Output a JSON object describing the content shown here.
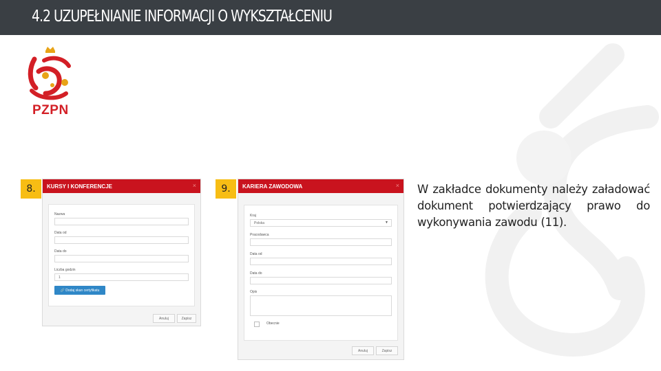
{
  "header": {
    "title": "4.2 UZUPEŁNIANIE INFORMACJI O WYKSZTAŁCENIU"
  },
  "logo": {
    "text": "PZPN"
  },
  "colors": {
    "header_bg": "#3a3f44",
    "accent_red": "#c9131e",
    "badge_yellow": "#f7bd14",
    "button_blue": "#2f87c7"
  },
  "step8": {
    "badge": "8.",
    "modal_title": "KURSY I KONFERENCJE",
    "close_icon": "×",
    "fields": [
      {
        "label": "Nazwa",
        "value": ""
      },
      {
        "label": "Data od",
        "value": ""
      },
      {
        "label": "Data do",
        "value": ""
      },
      {
        "label": "Liczba godzin",
        "value": "1"
      }
    ],
    "add_certificate_button": "🔗 Dodaj skan certyfikatu",
    "cancel_button": "Anuluj",
    "save_button": "Zapisz"
  },
  "step9": {
    "badge": "9.",
    "modal_title": "KARIERA ZAWODOWA",
    "close_icon": "×",
    "country_label": "Kraj",
    "country_value": "Polska",
    "country_caret": "▼",
    "fields": [
      {
        "label": "Pracodawca",
        "value": ""
      },
      {
        "label": "Data od",
        "value": ""
      },
      {
        "label": "Data do",
        "value": ""
      }
    ],
    "description_label": "Opis",
    "current_label": "Obecnie",
    "cancel_button": "Anuluj",
    "save_button": "Zapisz"
  },
  "description": "W zakładce dokumenty należy załadować dokument potwierdzający prawo do wykonywania zawodu (11)."
}
